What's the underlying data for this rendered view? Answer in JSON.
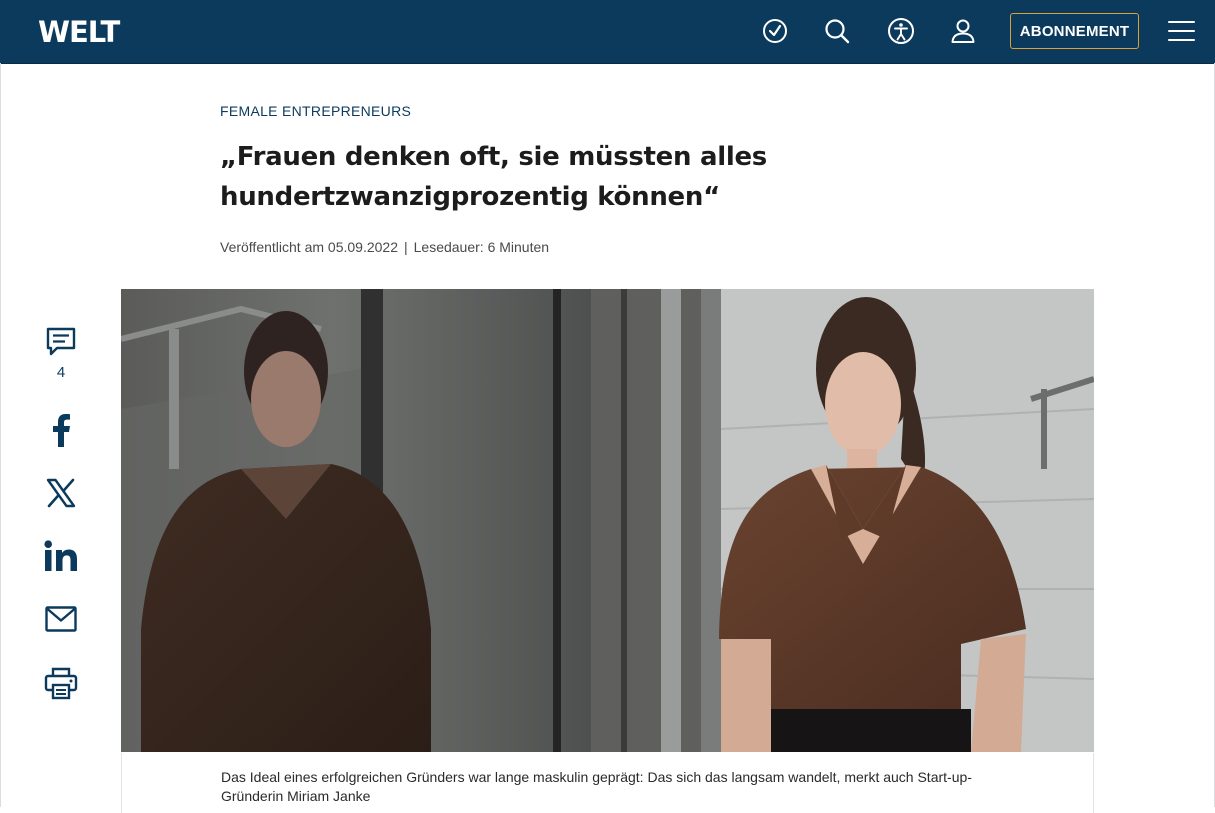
{
  "header": {
    "logo": "WELT",
    "icons": [
      "clock-icon",
      "search-icon",
      "accessibility-icon",
      "user-icon"
    ],
    "subscribe_label": "ABONNEMENT",
    "menu_icon": "hamburger-menu-icon",
    "bg_color": "#0b3a5c",
    "subscribe_border": "#d8a13a"
  },
  "article": {
    "kicker": "FEMALE ENTREPRENEURS",
    "headline_line1": "„Frauen denken oft, sie müssten alles",
    "headline_line2": "hundertzwanzigprozentig können“",
    "published": "Veröffentlicht am 05.09.2022",
    "separator": "|",
    "reading_time": "Lesedauer: 6 Minuten",
    "caption": "Das Ideal eines erfolgreichen Gründers war lange maskulin geprägt: Das sich das langsam wandelt, merkt auch Start-up-Gründerin Miriam Janke"
  },
  "share": {
    "comments_count": "4",
    "items": [
      "comment-icon",
      "facebook-icon",
      "x-icon",
      "linkedin-icon",
      "mail-icon",
      "print-icon"
    ],
    "color": "#0b3a5c"
  }
}
